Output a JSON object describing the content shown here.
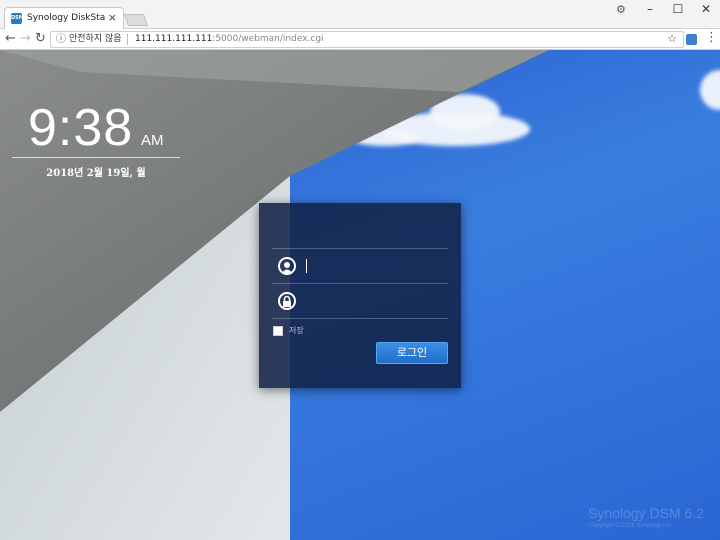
{
  "browser": {
    "tab_title": "Synology DiskStation -",
    "tab_favicon": "DSM",
    "tab_close": "×",
    "profile_icon": "⚙",
    "minimize": "–",
    "maximize": "☐",
    "close": "✕",
    "back": "←",
    "forward": "→",
    "reload": "↻",
    "info_icon": "ⓘ",
    "security_text": "안전하지 않음",
    "url_host": "111.111.111.111",
    "url_path": ":5000/webman/index.cgi",
    "bookmark_icon": "☆",
    "menu_icon": "⋮"
  },
  "clock": {
    "time": "9:38",
    "ampm": "AM",
    "date": "2018년 2월 19일, 월"
  },
  "login": {
    "username_value": "",
    "password_value": "",
    "remember_label": "저장",
    "login_button": "로그인"
  },
  "colors": {
    "sky": "#2f6fd6",
    "panel": "#122248",
    "button": "#2a7ad8"
  }
}
